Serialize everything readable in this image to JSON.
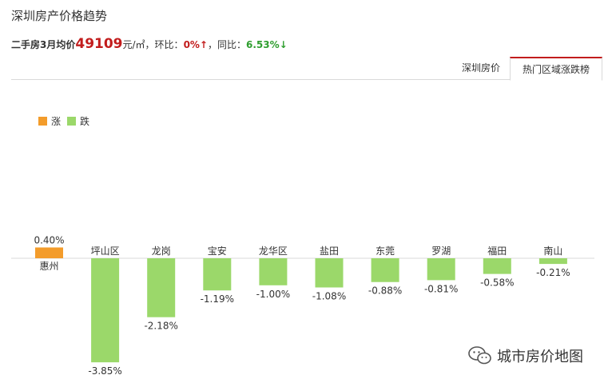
{
  "header": {
    "title": "深圳房产价格趋势",
    "summary_prefix": "二手房3月均价",
    "price": "49109",
    "unit": "元/㎡，环比：",
    "mom_value": "0%↑",
    "yoy_label": "，同比：",
    "yoy_value": "6.53%↓"
  },
  "tabs": [
    {
      "label": "深圳房价",
      "active": false
    },
    {
      "label": "热门区域涨跌榜",
      "active": true
    }
  ],
  "legend": [
    {
      "label": "涨",
      "color": "#f39c2b"
    },
    {
      "label": "跌",
      "color": "#9bd86a"
    }
  ],
  "watermark": {
    "text": "城市房价地图",
    "icon": "wechat-icon"
  },
  "colors": {
    "up": "#f39c2b",
    "down": "#9bd86a",
    "accent": "#c21d1d"
  },
  "chart_data": {
    "type": "bar",
    "categories": [
      "惠州",
      "坪山区",
      "龙岗",
      "宝安",
      "龙华区",
      "盐田",
      "东莞",
      "罗湖",
      "福田",
      "南山"
    ],
    "values": [
      0.4,
      -3.85,
      -2.18,
      -1.19,
      -1.0,
      -1.08,
      -0.88,
      -0.81,
      -0.58,
      -0.21
    ],
    "value_labels": [
      "0.40%",
      "-3.85%",
      "-2.18%",
      "-1.19%",
      "-1.00%",
      "-1.08%",
      "-0.88%",
      "-0.81%",
      "-0.58%",
      "-0.21%"
    ],
    "legend_position": "top-left",
    "grid": false
  }
}
